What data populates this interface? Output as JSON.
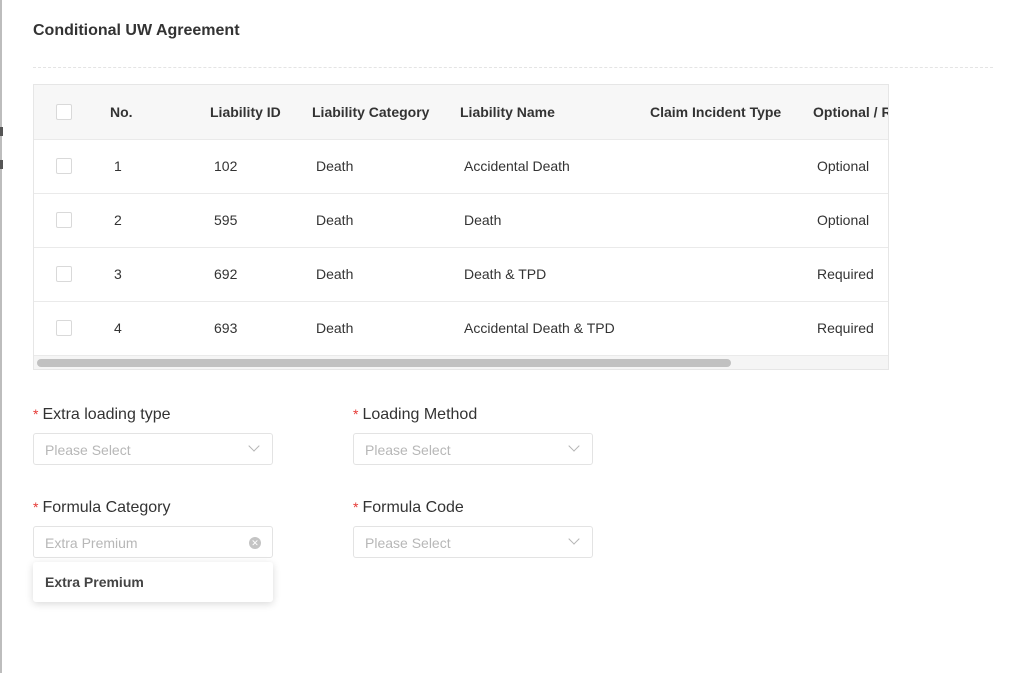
{
  "page": {
    "title": "Conditional UW Agreement"
  },
  "table": {
    "columns": [
      "No.",
      "Liability ID",
      "Liability Category",
      "Liability Name",
      "Claim Incident Type",
      "Optional / Required"
    ],
    "rows": [
      {
        "no": "1",
        "liability_id": "102",
        "category": "Death",
        "name": "Accidental Death",
        "incident_type": "",
        "optional": "Optional"
      },
      {
        "no": "2",
        "liability_id": "595",
        "category": "Death",
        "name": "Death",
        "incident_type": "",
        "optional": "Optional"
      },
      {
        "no": "3",
        "liability_id": "692",
        "category": "Death",
        "name": "Death & TPD",
        "incident_type": "",
        "optional": "Required"
      },
      {
        "no": "4",
        "liability_id": "693",
        "category": "Death",
        "name": "Accidental Death & TPD",
        "incident_type": "",
        "optional": "Required"
      }
    ]
  },
  "form": {
    "required_mark": "*",
    "extra_loading_type": {
      "label": "Extra loading type",
      "placeholder": "Please Select"
    },
    "loading_method": {
      "label": "Loading Method",
      "placeholder": "Please Select"
    },
    "formula_category": {
      "label": "Formula Category",
      "value": "Extra Premium"
    },
    "formula_code": {
      "label": "Formula Code",
      "placeholder": "Please Select"
    }
  },
  "dropdown": {
    "options": [
      "Extra Premium"
    ]
  },
  "icons": {
    "select_arrow": "chevron-down-icon",
    "clear": "clear-circle-icon"
  },
  "colors": {
    "required": "#e53935",
    "header_bg": "#f7f7f7"
  }
}
